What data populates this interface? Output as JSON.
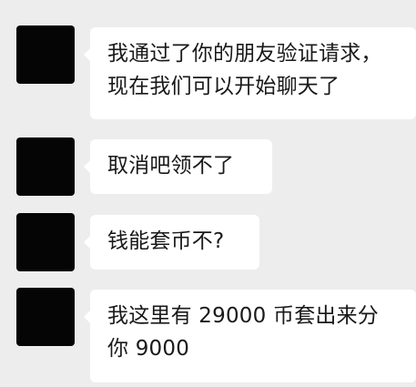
{
  "colors": {
    "background": "#ededed",
    "bubble": "#ffffff",
    "avatar": "#050505",
    "text": "#191919"
  },
  "messages": [
    {
      "lines": [
        "我通过了你的朋友验证请求，",
        "现在我们可以开始聊天了"
      ]
    },
    {
      "lines": [
        "取消吧领不了"
      ]
    },
    {
      "lines": [
        "钱能套币不?"
      ]
    },
    {
      "lines": [
        "我这里有 29000 币套出来分",
        "你 9000"
      ]
    }
  ]
}
